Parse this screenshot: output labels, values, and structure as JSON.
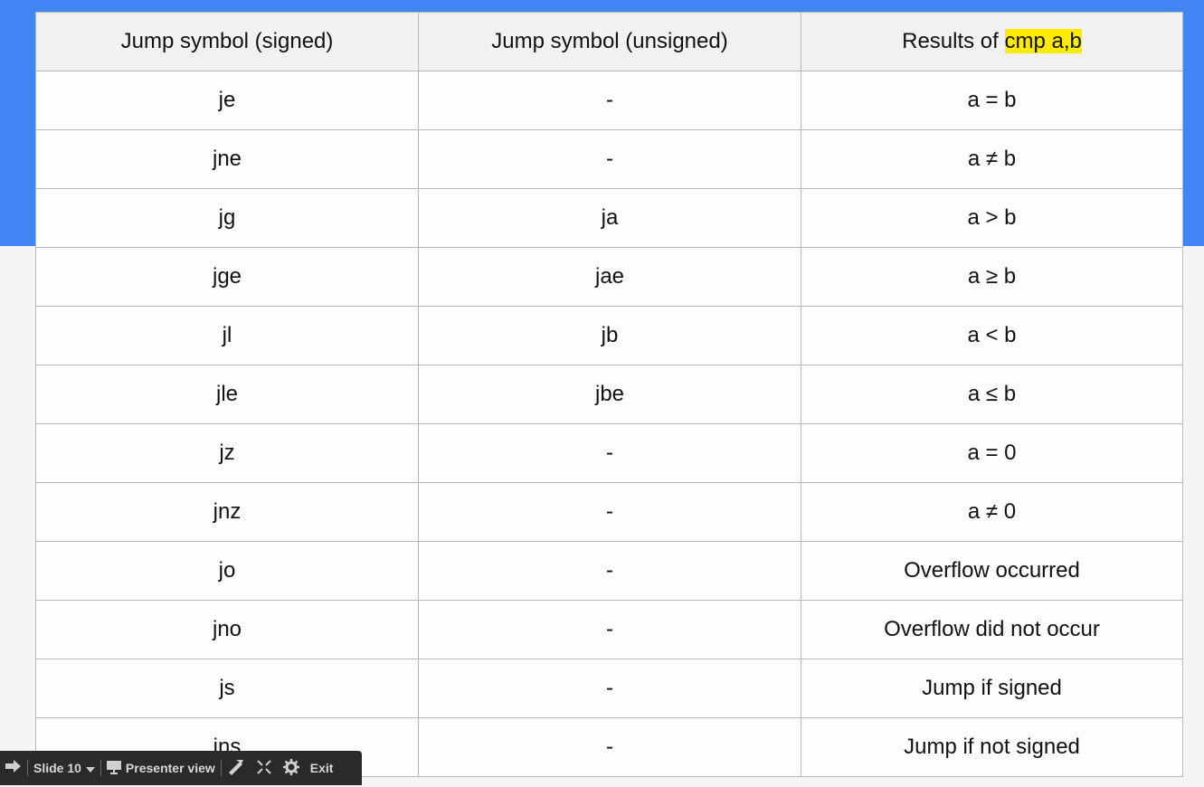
{
  "table": {
    "headers": [
      "Jump symbol (signed)",
      "Jump symbol (unsigned)",
      "Results of "
    ],
    "header_highlight": "cmp a,b",
    "rows": [
      [
        "je",
        "-",
        "a = b"
      ],
      [
        "jne",
        "-",
        "a ≠ b"
      ],
      [
        "jg",
        "ja",
        "a > b"
      ],
      [
        "jge",
        "jae",
        "a ≥ b"
      ],
      [
        "jl",
        "jb",
        "a < b"
      ],
      [
        "jle",
        "jbe",
        "a ≤ b"
      ],
      [
        "jz",
        "-",
        "a = 0"
      ],
      [
        "jnz",
        "-",
        "a ≠ 0"
      ],
      [
        "jo",
        "-",
        "Overflow occurred"
      ],
      [
        "jno",
        "-",
        "Overflow did not occur"
      ],
      [
        "js",
        "-",
        "Jump if signed"
      ],
      [
        "jns",
        "-",
        "Jump if not signed"
      ]
    ]
  },
  "toolbar": {
    "slide_label": "Slide 10",
    "presenter_label": "Presenter view",
    "exit_label": "Exit",
    "icons": [
      "arrow-right-icon",
      "chevron-down-icon",
      "presenter-icon",
      "laser-pointer-icon",
      "fullscreen-icon",
      "gear-icon"
    ]
  },
  "colors": {
    "accent_blue": "#4285f4",
    "highlight": "#ffeb00",
    "toolbar_bg": "#2a2a2a"
  }
}
